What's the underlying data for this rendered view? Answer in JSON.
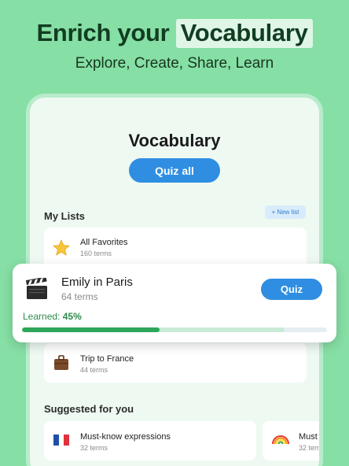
{
  "header": {
    "headline_part1": "Enrich your",
    "headline_highlight": "Vocabulary",
    "subline": "Explore, Create, Share, Learn"
  },
  "screen": {
    "title": "Vocabulary",
    "quiz_all_label": "Quiz all",
    "my_lists_label": "My Lists",
    "new_list_label": "New list",
    "lists": [
      {
        "icon": "star-icon",
        "title": "All Favorites",
        "terms": "160 terms"
      },
      {
        "icon": "suitcase-icon",
        "title": "Trip to France",
        "terms": "44 terms"
      }
    ],
    "suggested_label": "Suggested for you",
    "suggested": [
      {
        "icon": "france-flag-icon",
        "title": "Must-know expressions",
        "terms": "32 terms"
      },
      {
        "icon": "rainbow-icon",
        "title": "Must",
        "terms": "32 terms"
      }
    ]
  },
  "popup": {
    "icon": "clapperboard-icon",
    "title": "Emily in Paris",
    "terms": "64 terms",
    "quiz_label": "Quiz",
    "learned_label": "Learned:",
    "learned_value": "45%",
    "learned_fraction": 0.45
  },
  "colors": {
    "background": "#86dfa5",
    "accent_blue": "#2f8ee2",
    "progress_green": "#2ea65a"
  }
}
